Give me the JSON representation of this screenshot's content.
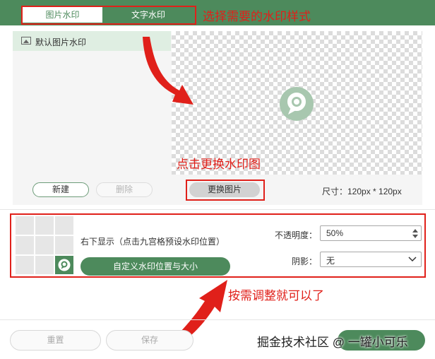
{
  "header": {
    "tabs": [
      {
        "label": "图片水印",
        "active": true
      },
      {
        "label": "文字水印",
        "active": false
      }
    ],
    "annotation": "选择需要的水印样式"
  },
  "image_panel": {
    "list_items": [
      {
        "label": "默认图片水印",
        "selected": true
      }
    ],
    "preview_annotation": "点击更换水印图",
    "new_button": "新建",
    "delete_button": "删除",
    "replace_button": "更换图片",
    "size_text": "尺寸：120px * 120px"
  },
  "position_panel": {
    "grid_selected_cell": 9,
    "position_text": "右下显示（点击九宫格预设水印位置）",
    "custom_button": "自定义水印位置与大小",
    "opacity_label": "不透明度：",
    "opacity_value": "50%",
    "shadow_label": "阴影：",
    "shadow_value": "无",
    "annotation": "按需调整就可以了"
  },
  "footer": {
    "reset_button": "重置",
    "save_button": "保存",
    "watermark_text": "掘金技术社区 @ 一罐小可乐"
  },
  "colors": {
    "brand_green": "#4d8a5c",
    "highlight_red": "#e0201a"
  }
}
